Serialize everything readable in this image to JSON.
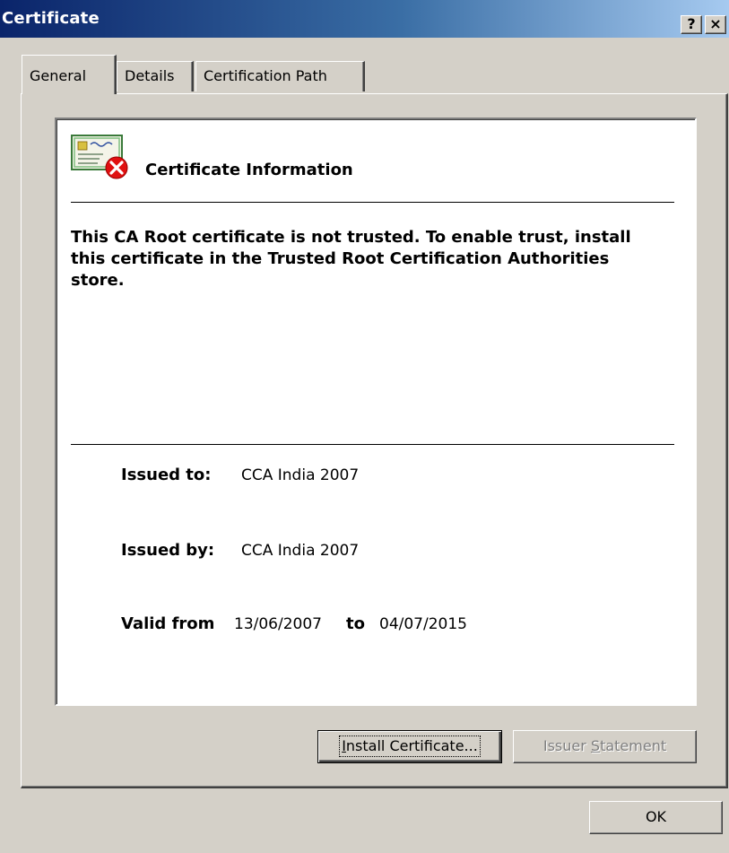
{
  "window": {
    "title": "Certificate",
    "help_label": "?",
    "close_label": "×"
  },
  "tabs": [
    {
      "label": "General",
      "selected": true
    },
    {
      "label": "Details",
      "selected": false
    },
    {
      "label": "Certification Path",
      "selected": false
    }
  ],
  "info": {
    "title": "Certificate Information",
    "warning": "This CA Root certificate is not trusted. To enable trust, install this certificate in the Trusted Root Certification Authorities store.",
    "issued_to_label": "Issued to:",
    "issued_to_value": "CCA India 2007",
    "issued_by_label": "Issued by:",
    "issued_by_value": "CCA India 2007",
    "valid_from_label": "Valid from",
    "valid_from_value": "13/06/2007",
    "valid_to_label": "to",
    "valid_to_value": "04/07/2015",
    "icon": "certificate-error-icon"
  },
  "buttons": {
    "install_prefix": "",
    "install_accel": "I",
    "install_rest": "nstall Certificate...",
    "issuer_prefix": "Issuer ",
    "issuer_accel": "S",
    "issuer_rest": "tatement",
    "ok": "OK"
  },
  "colors": {
    "title_start": "#0a246a",
    "title_end": "#a6caf0",
    "face": "#d4d0c8",
    "error": "#e01010"
  }
}
